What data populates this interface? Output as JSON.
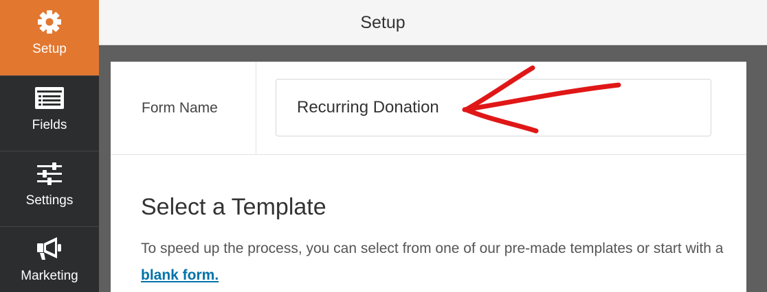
{
  "sidebar": {
    "items": [
      {
        "label": "Setup",
        "icon": "gear-icon",
        "active": true
      },
      {
        "label": "Fields",
        "icon": "fields-icon",
        "active": false
      },
      {
        "label": "Settings",
        "icon": "sliders-icon",
        "active": false
      },
      {
        "label": "Marketing",
        "icon": "megaphone-icon",
        "active": false
      }
    ],
    "active_color": "#e27730",
    "background_color": "#2c2d2e"
  },
  "header": {
    "title": "Setup"
  },
  "form_name": {
    "label": "Form Name",
    "value": "Recurring Donation"
  },
  "templates": {
    "title": "Select a Template",
    "description": "To speed up the process, you can select from one of our pre-made templates or start with a ",
    "blank_link": "blank form."
  },
  "annotation": {
    "type": "arrow",
    "color": "#e01717",
    "points_to": "form-name-input"
  }
}
